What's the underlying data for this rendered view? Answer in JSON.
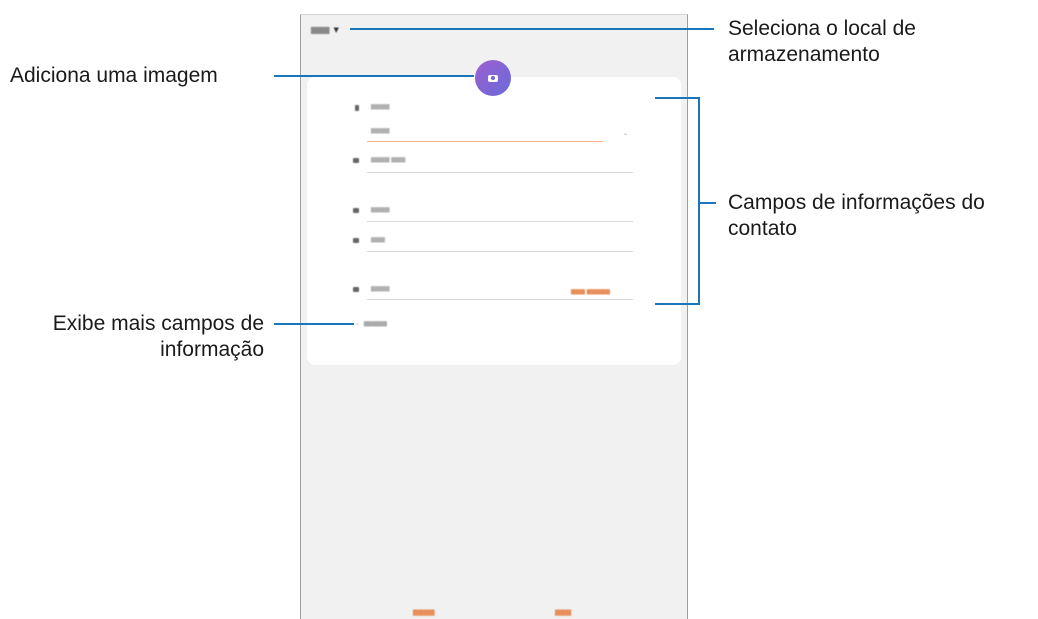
{
  "callouts": {
    "storage": "Seleciona o local de armazenamento",
    "storage_l1": "Seleciona o local de",
    "storage_l2": "armazenamento",
    "image": "Adiciona uma imagem",
    "fields_l1": "Campos de informações do",
    "fields_l2": "contato",
    "more_l1": "Exibe mais campos de",
    "more_l2": "informação"
  },
  "colors": {
    "callout_line": "#1b75bb",
    "accent": "#e88e5a",
    "avatar": "#7a62d4"
  }
}
